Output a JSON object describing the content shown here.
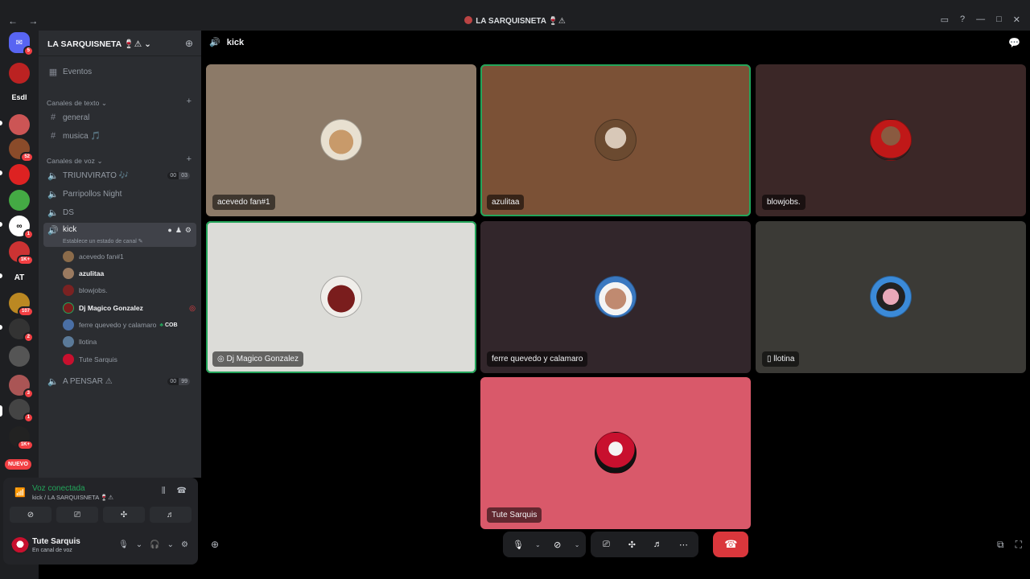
{
  "window": {
    "title": "LA SARQUISNETA 🍷⚠",
    "back": "←",
    "forward": "→"
  },
  "rail": {
    "badges": [
      "5",
      "52",
      "1",
      "1K+",
      "107",
      "2",
      "3",
      "1",
      "1K+"
    ],
    "labels": [
      "Esdl",
      "AT"
    ],
    "nuevo": "NUEVO"
  },
  "guild": {
    "name": "LA SARQUISNETA 🍷⚠ ⌄"
  },
  "sidebar": {
    "events": "Eventos",
    "text_category": "Canales de texto ⌄",
    "text_channels": [
      "general",
      "musica 🎵"
    ],
    "voice_category": "Canales de voz ⌄",
    "voice_channels": [
      {
        "name": "TRIUNVIRATO 🎶",
        "count_a": "00",
        "count_b": "03"
      },
      {
        "name": "Parripollos Night"
      },
      {
        "name": "DS"
      }
    ],
    "active_channel": {
      "name": "kick",
      "status_hint": "Establece un estado de canal ✎"
    },
    "members": [
      {
        "name": "acevedo fan#1",
        "bold": false
      },
      {
        "name": "azulitaa",
        "bold": true
      },
      {
        "name": "blowjobs.",
        "bold": false
      },
      {
        "name": "Dj Magico Gonzalez",
        "bold": true
      },
      {
        "name": "ferre quevedo y calamaro",
        "bold": false,
        "tag": "COB"
      },
      {
        "name": "llotina",
        "bold": false
      },
      {
        "name": "Tute Sarquis",
        "bold": false
      }
    ],
    "last_channel": {
      "name": "A PENSAR ⚠",
      "count_a": "00",
      "count_b": "99"
    }
  },
  "voice_panel": {
    "status": "Voz conectada",
    "sub": "kick / LA SARQUISNETA 🍷⚠"
  },
  "user": {
    "name": "Tute Sarquis",
    "status": "En canal de voz"
  },
  "stage": {
    "channel": "kick",
    "tiles": [
      {
        "label": "acevedo fan#1",
        "bg": "#8c7a68",
        "speaking": false
      },
      {
        "label": "azulitaa",
        "bg": "#7b5136",
        "speaking": true
      },
      {
        "label": "blowjobs.",
        "bg": "#3b2727",
        "speaking": false
      },
      {
        "label": "Dj Magico Gonzalez",
        "bg": "#dcdcd8",
        "speaking": true
      },
      {
        "label": "ferre quevedo y calamaro",
        "bg": "#32262b",
        "speaking": false
      },
      {
        "label": "llotina",
        "bg": "#3b3a36",
        "speaking": false
      },
      {
        "label": "Tute Sarquis",
        "bg": "#d9596a",
        "speaking": false
      }
    ]
  },
  "colors": {
    "accent_green": "#23a55a",
    "danger": "#da373c",
    "sidebar_bg": "#2b2d31"
  }
}
